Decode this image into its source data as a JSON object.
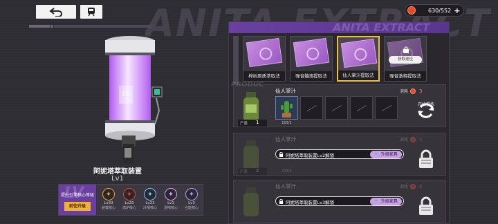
{
  "header": {
    "bg_title": "ANITA EXTRACT",
    "back_icon": "back-arrow-icon",
    "train_icon": "train-icon",
    "currency": {
      "icon": "energy-orb-icon",
      "value": "630/552",
      "plus_label": "+"
    }
  },
  "device": {
    "name": "阿妮塔萃取装置",
    "level": "Lv1",
    "canister_label": "10"
  },
  "core_panel": {
    "watermark": "LV",
    "title": "提升引擎核心等级",
    "button_label": "前往升级",
    "items": [
      {
        "level": "Lv20",
        "name": "超载核心",
        "icon": "overload-core-icon",
        "color": "#f0a030"
      },
      {
        "level": "Lv20",
        "name": "熔炉核心",
        "icon": "furnace-core-icon",
        "color": "#e2442a"
      },
      {
        "level": "Lv23",
        "name": "冷凝核心",
        "icon": "condense-core-icon",
        "color": "#6ec8ff"
      },
      {
        "level": "Lv1",
        "name": "混响核心",
        "icon": "reverb-core-icon",
        "color": "#d7a3ff"
      },
      {
        "level": "Lv3",
        "name": "合能核心",
        "icon": "fusion-core-icon",
        "color": "#b59cff"
      }
    ]
  },
  "methods": {
    "header_watermark": "ANITA EXTRACT",
    "tabs": [
      {
        "label": "榨树原质萃取法",
        "active": false,
        "locked": false
      },
      {
        "label": "噪音髓液提取法",
        "active": false,
        "locked": false
      },
      {
        "label": "仙人掌汁提取法",
        "active": true,
        "locked": false
      },
      {
        "label": "噪音激释提取法",
        "active": false,
        "locked": true,
        "get_label": "获取途径"
      }
    ]
  },
  "slots": [
    {
      "watermark": "PRODUC",
      "name": "仙人掌汁",
      "cost_label": "消耗",
      "cost_value": "3",
      "qty_label": "产量",
      "qty_value": "1",
      "first_count": "103/1",
      "action_label": "开始提炼",
      "locked": false
    },
    {
      "name": "仙人掌汁",
      "cost_label": "消耗",
      "cost_value": "5",
      "qty_label": "产量",
      "qty_value": "2",
      "first_count": "103/2",
      "lock_text": "阿妮塔萃取装置Lv2解锁",
      "upgrade_label": "升级家具",
      "locked": true
    },
    {
      "name": "仙人掌汁",
      "cost_label": "消耗",
      "cost_value": "6",
      "lock_text": "阿妮塔萃取装置Lv3解锁",
      "upgrade_label": "升级家具",
      "locked": true
    }
  ]
}
